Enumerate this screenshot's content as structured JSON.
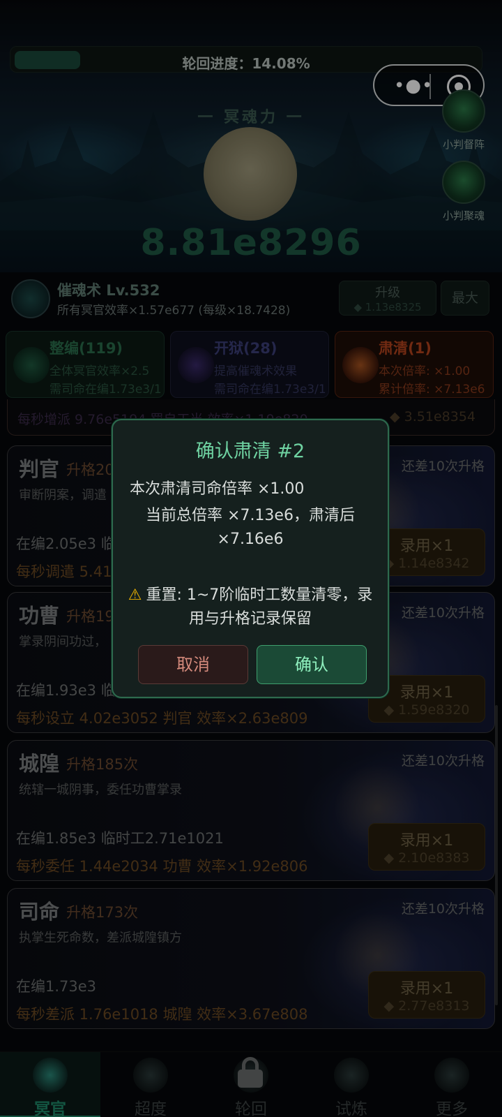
{
  "progress": {
    "label": "轮回进度：14.08%",
    "fraction": 0.1408
  },
  "capsule": {
    "menu_icon": "more-dots-icon",
    "close_icon": "target-circle-icon"
  },
  "side_buttons": [
    {
      "label": "小判督阵",
      "icon": "skull-banner-icon"
    },
    {
      "label": "小判聚魂",
      "icon": "ghost-skull-icon"
    }
  ],
  "power": {
    "title": "一 冥魂力 一",
    "value": "8.81e8296"
  },
  "skill": {
    "name": "催魂术 Lv.532",
    "desc": "所有冥官效率×1.57e677 (每级×18.7428)",
    "upgrade_label": "升级",
    "upgrade_cost": "◆ 1.13e8325",
    "max_label": "最大"
  },
  "tabs": [
    {
      "title": "整编(119)",
      "line1": "全体冥官效率×2.5",
      "line2": "需司命在编1.73e3/1"
    },
    {
      "title": "开狱(28)",
      "line1": "提高催魂术效果",
      "line2": "需司命在编1.73e3/1"
    },
    {
      "title": "肃清(1)",
      "line1": "本次倍率: ×1.00",
      "line2": "累计倍率: ×7.13e6"
    }
  ],
  "list_top": {
    "text": "每秒增派 9.76e5194 罚自工当 效率×1.19e820",
    "price": "◆ 3.51e8354"
  },
  "cards": [
    {
      "name": "判官",
      "sub": "升格20",
      "desc": "审断阴案，调遣",
      "need": "还差10次升格",
      "stat": "在编2.05e3  临",
      "rate": "每秒调遣 5.41",
      "buy": "录用×1",
      "price": "◆ 1.14e8342"
    },
    {
      "name": "功曹",
      "sub": "升格19",
      "desc": "掌录阴间功过，",
      "need": "还差10次升格",
      "stat": "在编1.93e3  临",
      "rate": "每秒设立 4.02e3052 判官  效率×2.63e809",
      "buy": "录用×1",
      "price": "◆ 1.59e8320"
    },
    {
      "name": "城隍",
      "sub": "升格185次",
      "desc": "统辖一城阴事，委任功曹掌录",
      "need": "还差10次升格",
      "stat": "在编1.85e3  临时工2.71e1021",
      "rate": "每秒委任 1.44e2034 功曹  效率×1.92e806",
      "buy": "录用×1",
      "price": "◆ 2.10e8383"
    },
    {
      "name": "司命",
      "sub": "升格173次",
      "desc": "执掌生死命数，差派城隍镇方",
      "need": "还差10次升格",
      "stat": "在编1.73e3",
      "rate": "每秒差派 1.76e1018 城隍  效率×3.67e808",
      "buy": "录用×1",
      "price": "◆ 2.77e8313"
    }
  ],
  "modal": {
    "title": "确认肃清 #2",
    "line1": "本次肃清司命倍率 ×1.00",
    "line2": "当前总倍率 ×7.13e6，肃清后 ×7.16e6",
    "warning_icon": "warning-triangle-icon",
    "warning": "重置: 1~7阶临时工数量清零，录用与升格记录保留",
    "cancel": "取消",
    "confirm": "确认"
  },
  "nav": [
    {
      "label": "冥官",
      "icon": "ghost-official-icon",
      "active": true
    },
    {
      "label": "超度",
      "icon": "temple-icon",
      "active": false
    },
    {
      "label": "轮回",
      "icon": "lock-icon",
      "active": false
    },
    {
      "label": "试炼",
      "icon": "flame-icon",
      "active": false
    },
    {
      "label": "更多",
      "icon": "more-icon",
      "active": false
    }
  ],
  "colors": {
    "accent": "#6fd3a2",
    "confirm_bg": "#1b4a36",
    "cancel_text": "#d48a7c",
    "warning": "#f0b400"
  }
}
